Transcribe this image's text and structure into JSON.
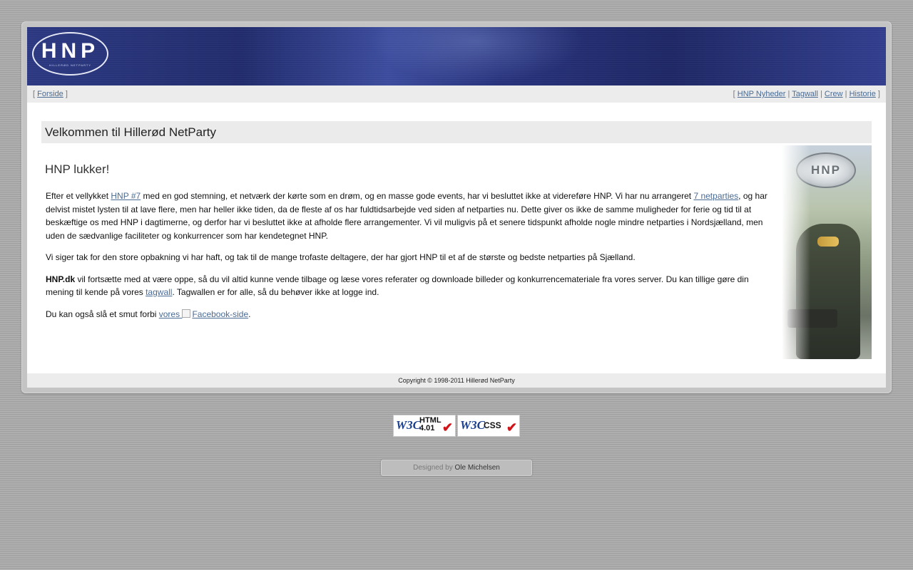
{
  "header": {
    "logo_text": "HNP",
    "logo_sub": "HILLERØD NETPARTY",
    "nav_left": [
      {
        "label": "Forside"
      }
    ],
    "nav_right": [
      {
        "label": "HNP Nyheder"
      },
      {
        "label": "Tagwall"
      },
      {
        "label": "Crew"
      },
      {
        "label": "Historie"
      }
    ]
  },
  "main": {
    "welcome_title": "Velkommen til Hillerød NetParty",
    "heading": "HNP lukker!",
    "p1": {
      "t1": "Efter et vellykket ",
      "link1": "HNP #7",
      "t2": " med en god stemning, et netværk der kørte som en drøm, og en masse gode events, har vi besluttet ikke at videreføre HNP. Vi har nu arrangeret ",
      "link2": "7 netparties",
      "t3": ", og har delvist mistet lysten til at lave flere, men har heller ikke tiden, da de fleste af os har fuldtidsarbejde ved siden af netparties nu. Dette giver os ikke de samme muligheder for ferie og tid til at beskæftige os med HNP i dagtimerne, og derfor har vi besluttet ikke at afholde flere arrangementer. Vi vil muligvis på et senere tidspunkt afholde nogle mindre netparties i Nordsjælland, men uden de sædvanlige faciliteter og konkurrencer som har kendetegnet HNP."
    },
    "p2": "Vi siger tak for den store opbakning vi har haft, og tak til de mange trofaste deltagere, der har gjort HNP til et af de største og bedste netparties på Sjælland.",
    "p3": {
      "bold": "HNP.dk",
      "t1": " vil fortsætte med at være oppe, så du vil altid kunne vende tilbage og læse vores referater og downloade billeder og konkurrencemateriale fra vores server. Du kan tillige gøre din mening til kende på vores ",
      "link": "tagwall",
      "t2": ". Tagwallen er for alle, så du behøver ikke at logge ind."
    },
    "p4": {
      "t1": "Du kan også slå et smut forbi ",
      "link": "vores ",
      "img_alt": "Facebook-side",
      "t2": "."
    },
    "side_logo": "HNP"
  },
  "footer": {
    "copyright": "Copyright © 1998-2011 Hillerød NetParty"
  },
  "badges": [
    {
      "w3c": "W3C",
      "label": "HTML 4.01"
    },
    {
      "w3c": "W3C",
      "label": "CSS"
    }
  ],
  "designer": {
    "prefix": "Designed by ",
    "name": "Ole Michelsen"
  }
}
